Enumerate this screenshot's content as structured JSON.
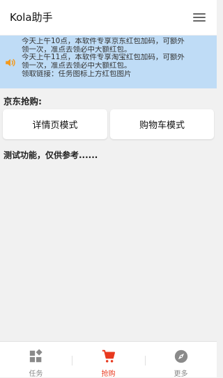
{
  "header": {
    "title": "Kola助手",
    "menu_icon": "hamburger-menu-icon"
  },
  "notice": {
    "icon": "speaker-icon",
    "lines": [
      "今天上午10点，本软件专享京东红包加码，可额外",
      "领一次，准点去领必中大额红包。",
      "今天上午11点，本软件专享淘宝红包加码，可额外",
      "领一次，准点去领必中大额红包。",
      "领取链接：任务图标上方红包图片"
    ]
  },
  "main": {
    "section_label": "京东抢购:",
    "buttons": {
      "detail_mode": "详情页模式",
      "cart_mode": "购物车模式"
    },
    "note": "测试功能，仅供参考......"
  },
  "tabbar": {
    "tabs": [
      {
        "label": "任务",
        "icon": "tasks-grid-icon",
        "active": false
      },
      {
        "label": "抢购",
        "icon": "shopping-cart-icon",
        "active": true
      },
      {
        "label": "更多",
        "icon": "compass-icon",
        "active": false
      }
    ]
  },
  "colors": {
    "accent": "#e8391f",
    "notice_bg": "#bfdcf6",
    "speaker": "#f39a1e",
    "inactive_icon": "#888888"
  }
}
